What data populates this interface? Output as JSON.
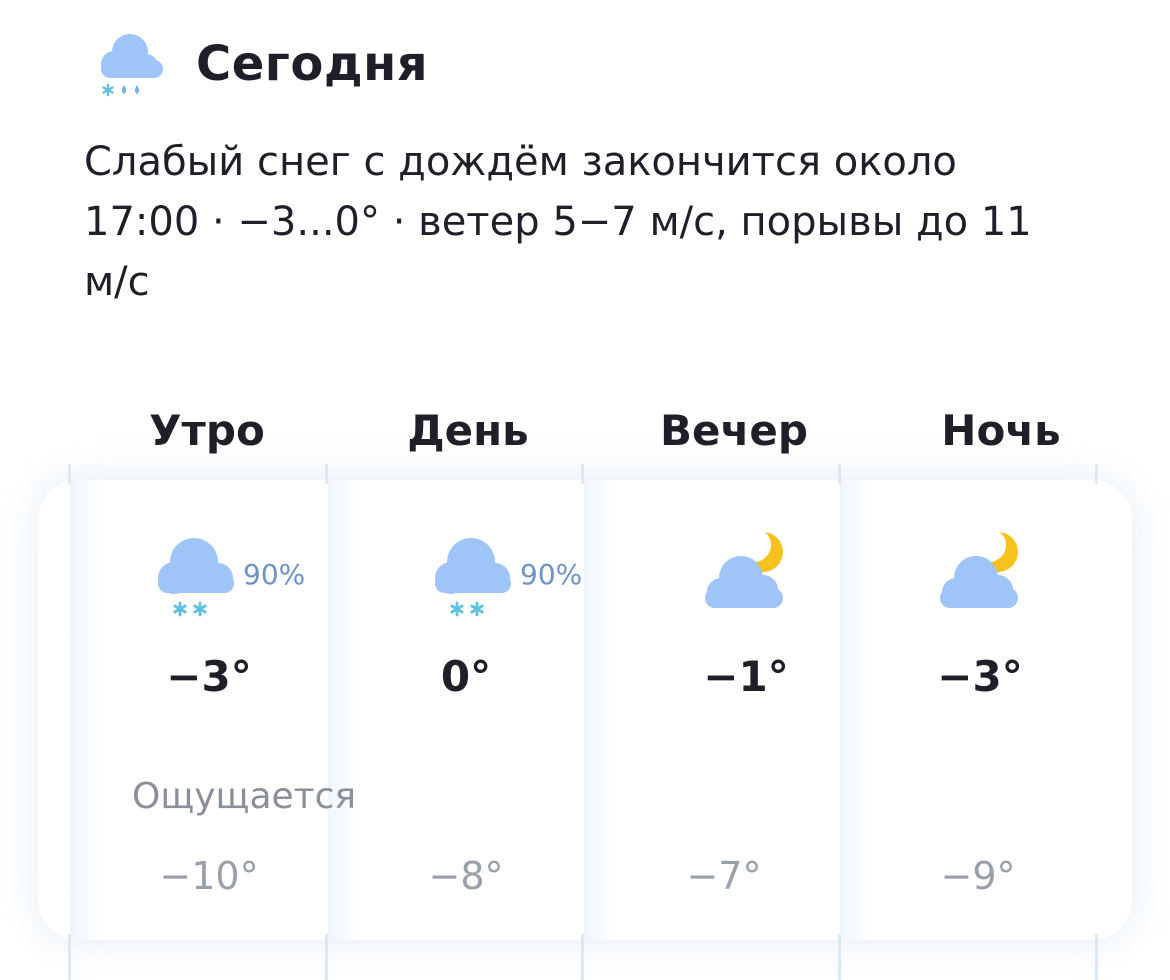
{
  "header": {
    "icon": "cloud-sleet-icon",
    "title": "Сегодня"
  },
  "summary": "Слабый снег с дождём закончится около 17:00 · −3...0° · ветер 5−7 м/с, порывы до 11 м/с",
  "feels_label": "Ощущается",
  "parts": [
    {
      "label": "Утро",
      "icon": "cloud-snow-icon",
      "probability": "90%",
      "temp": "−3°",
      "feels": "−10°"
    },
    {
      "label": "День",
      "icon": "cloud-snow-icon",
      "probability": "90%",
      "temp": "0°",
      "feels": "−8°"
    },
    {
      "label": "Вечер",
      "icon": "cloud-moon-icon",
      "probability": "",
      "temp": "−1°",
      "feels": "−7°"
    },
    {
      "label": "Ночь",
      "icon": "cloud-moon-icon",
      "probability": "",
      "temp": "−3°",
      "feels": "−9°"
    }
  ],
  "colors": {
    "cloud": "#9ec4f8",
    "snow": "#5fc1df",
    "rain": "#7ab0e8",
    "moon": "#f7c21d",
    "probability": "#6d93c7",
    "text": "#1f1f29",
    "muted": "#9aa0aa"
  }
}
